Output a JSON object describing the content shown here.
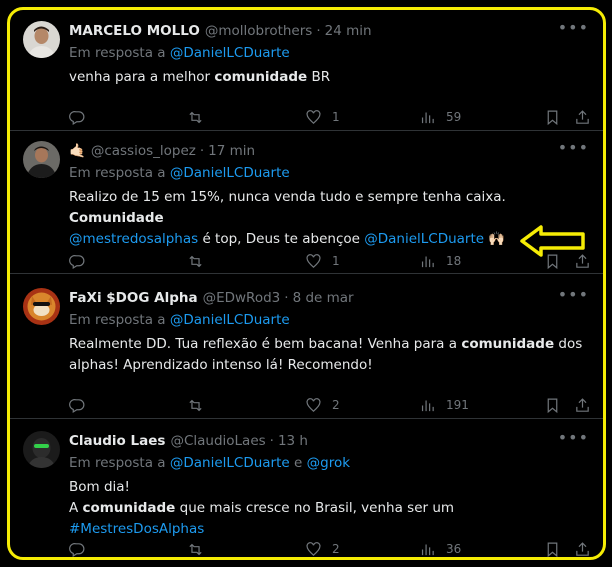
{
  "colors": {
    "accent": "#1d9bf0",
    "highlight": "#f5ec05"
  },
  "tweets": [
    {
      "name": "MARCELO MOLLO",
      "handle": "@mollobrothers",
      "time": "24 min",
      "reply_prefix": "Em resposta a",
      "reply_to": "@DanielLCDuarte",
      "text_1": "venha para a melhor ",
      "text_bold": "comunidade",
      "text_2": " BR",
      "replies": "",
      "retweets": "",
      "likes": "1",
      "views": "59"
    },
    {
      "name": "",
      "emoji": "🤙🏻",
      "handle": "@cassios_lopez",
      "time": "17 min",
      "reply_prefix": "Em resposta a",
      "reply_to": "@DanielLCDuarte",
      "text_1": "Realizo de 15 em 15%, nunca venda tudo e sempre tenha caixa. ",
      "text_bold": "Comunidade",
      "text_mention_1": "@mestredosalphas",
      "text_2": " é top, Deus te abençoe ",
      "text_mention_2": "@DanielLCDuarte",
      "text_emoji": " 🙌🏻",
      "likes": "1",
      "views": "18"
    },
    {
      "name": "FaXi $DOG Alpha",
      "handle": "@EDwRod3",
      "time": "8 de mar",
      "reply_prefix": "Em resposta a",
      "reply_to": "@DanielLCDuarte",
      "text_1": "Realmente DD. Tua reflexão é bem bacana! Venha para a ",
      "text_bold": "comunidade",
      "text_2": " dos alphas! Aprendizado intenso lá! Recomendo!",
      "likes": "2",
      "views": "191"
    },
    {
      "name": "Claudio Laes",
      "handle": "@ClaudioLaes",
      "time": "13 h",
      "reply_prefix": "Em resposta a",
      "reply_to": "@DanielLCDuarte",
      "reply_and": "e",
      "reply_to_2": "@grok",
      "text_line1": "Bom dia!",
      "text_1": "A ",
      "text_bold": "comunidade",
      "text_2": " que mais cresce no Brasil, venha ser um ",
      "text_hashtag": "#MestresDosAlphas",
      "likes": "2",
      "views": "36"
    }
  ]
}
